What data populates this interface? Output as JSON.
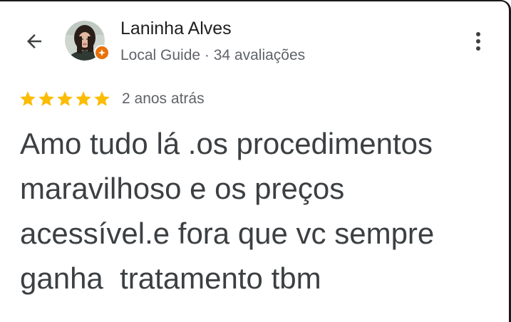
{
  "header": {
    "back_icon": "arrow-back-icon",
    "reviewer_name": "Laninha Alves",
    "reviewer_meta": "Local Guide · 34 avaliações",
    "badge_icon": "local-guide-badge-icon",
    "badge_color": "#e8710a",
    "more_icon": "more-vert-icon"
  },
  "review": {
    "rating": 5,
    "rating_max": 5,
    "star_color": "#fbbc04",
    "age": "2 anos atrás",
    "text": "Amo tudo lá .os procedimentos\nmaravilhoso e os preços\nacessível.e fora que vc sempre\nganha  tratamento tbm"
  }
}
